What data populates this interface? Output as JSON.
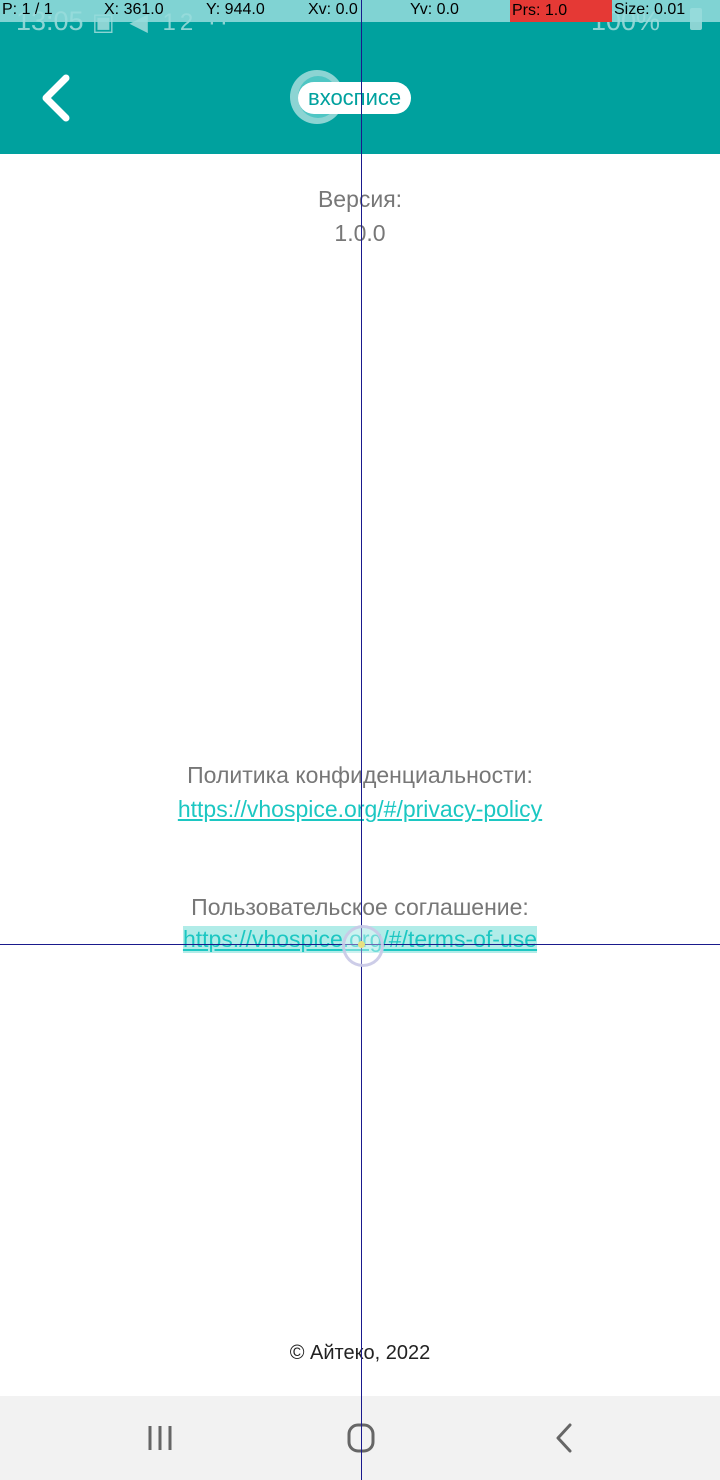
{
  "status_bar": {
    "time": "13:05",
    "left_icons": "▣ ◀ 12 ··",
    "battery_text": "100%"
  },
  "pointer_overlay": {
    "pointer": "P: 1 / 1",
    "x": "X: 361.0",
    "y": "Y: 944.0",
    "xv": "Xv: 0.0",
    "yv": "Yv: 0.0",
    "prs": "Prs: 1.0",
    "size": "Size: 0.01"
  },
  "header": {
    "logo_text": "вхосписе"
  },
  "content": {
    "version_label": "Версия:",
    "version_value": "1.0.0",
    "privacy_label": "Политика конфиденциальности:",
    "privacy_link": "https://vhospice.org/#/privacy-policy",
    "terms_label": "Пользовательское соглашение:",
    "terms_link": "https://vhospice.org/#/terms-of-use",
    "copyright": "© Айтеко, 2022"
  },
  "colors": {
    "header_bg": "#00a19e",
    "link": "#1cc7c2",
    "label_text": "#777777"
  },
  "icons": {
    "back": "chevron-left-icon",
    "nav_recents": "recents-icon",
    "nav_home": "home-icon",
    "nav_back": "back-icon"
  }
}
